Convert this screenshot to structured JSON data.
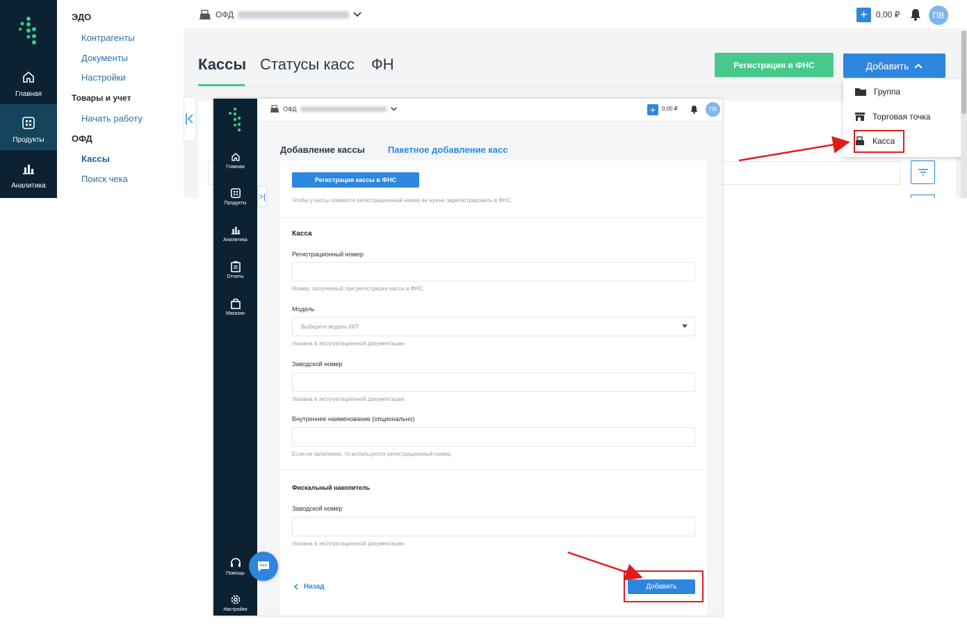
{
  "big": {
    "rail": {
      "items": [
        {
          "label": "Главная",
          "icon": "home-icon"
        },
        {
          "label": "Продукты",
          "icon": "grid-icon"
        },
        {
          "label": "Аналитика",
          "icon": "bar-chart-icon"
        }
      ]
    },
    "sidebar": {
      "edo_header": "ЭДО",
      "edo_links": [
        "Контрагенты",
        "Документы",
        "Настройки"
      ],
      "goods_header": "Товары и учет",
      "goods_links": [
        "Начать работу"
      ],
      "ofd_header": "ОФД",
      "ofd_links": [
        "Кассы",
        "Поиск чека"
      ]
    },
    "topbar": {
      "ofd_label": "ОФД",
      "balance": "0,00 ₽",
      "avatar": "ПВ"
    },
    "tabs": [
      "Кассы",
      "Статусы касс",
      "ФН"
    ],
    "register_fns_button": "Регистрация в ФНС",
    "add_button": "Добавить",
    "add_menu": [
      "Группа",
      "Торговая точка",
      "Касса"
    ],
    "colors": {
      "accent": "#2e86de",
      "green": "#46c98a",
      "rail": "#0c2233",
      "highlight": "#e01b1b"
    }
  },
  "small": {
    "rail": {
      "items": [
        "Главная",
        "Продукты",
        "Аналитика",
        "Отчеты",
        "Магазин"
      ],
      "bottom_items": [
        "Помощь",
        "Настройки"
      ]
    },
    "topbar": {
      "ofd_label": "ОФД",
      "balance": "0,00 ₽",
      "avatar": "ПВ"
    },
    "tabs": [
      "Добавление кассы",
      "Пакетное добавление касс"
    ],
    "register_button": "Регистрация кассы в ФНС",
    "register_hint": "Чтобы у кассы появился регистрационный номер ее нужно зарегистрировать в ФНС.",
    "kassa_section": "Касса",
    "fields": [
      {
        "label": "Регистрационный номер",
        "hint": "Номер, полученный при регистрации кассы в ФНС."
      },
      {
        "label": "Модель",
        "placeholder": "Выберите модель ККТ",
        "hint": "Указана в эксплуатационной документации."
      },
      {
        "label": "Заводской номер",
        "hint": "Указана в эксплуатационной документации."
      },
      {
        "label": "Внутреннее наименование (опционально)",
        "hint": "Если не заполнено, то используется регистрационный номер."
      }
    ],
    "fn_section": "Фискальный накопитель",
    "fn_field": {
      "label": "Заводской номер",
      "hint": "Указана в эксплуатационной документации."
    },
    "back_button": "Назад",
    "submit_button": "Добавить"
  }
}
